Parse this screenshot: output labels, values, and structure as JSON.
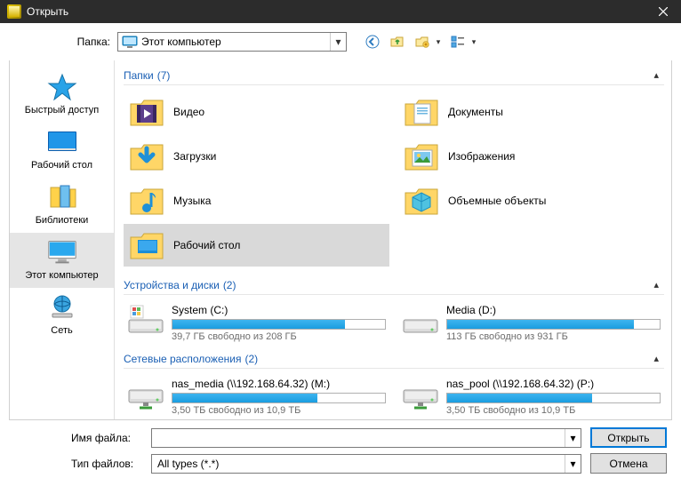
{
  "title": "Открыть",
  "topbar": {
    "folder_label": "Папка:",
    "current_folder": "Этот компьютер"
  },
  "sidebar": {
    "items": [
      {
        "id": "quick",
        "label": "Быстрый доступ"
      },
      {
        "id": "desktop",
        "label": "Рабочий стол"
      },
      {
        "id": "libraries",
        "label": "Библиотеки"
      },
      {
        "id": "thispc",
        "label": "Этот компьютер"
      },
      {
        "id": "network",
        "label": "Сеть"
      }
    ],
    "selected": "thispc"
  },
  "groups": {
    "folders": {
      "title": "Папки",
      "count": "(7)"
    },
    "drives": {
      "title": "Устройства и диски",
      "count": "(2)"
    },
    "network": {
      "title": "Сетевые расположения",
      "count": "(2)"
    }
  },
  "folders": [
    {
      "id": "videos",
      "label": "Видео"
    },
    {
      "id": "documents",
      "label": "Документы"
    },
    {
      "id": "downloads",
      "label": "Загрузки"
    },
    {
      "id": "pictures",
      "label": "Изображения"
    },
    {
      "id": "music",
      "label": "Музыка"
    },
    {
      "id": "3dobjects",
      "label": "Объемные объекты"
    },
    {
      "id": "desktop",
      "label": "Рабочий стол",
      "selected": true
    }
  ],
  "drives": [
    {
      "name": "System (C:)",
      "free": "39,7 ГБ свободно из 208 ГБ",
      "fill_pct": 81,
      "type": "win"
    },
    {
      "name": "Media (D:)",
      "free": "113 ГБ свободно из 931 ГБ",
      "fill_pct": 88,
      "type": "hdd"
    }
  ],
  "netdrives": [
    {
      "name": "nas_media (\\\\192.168.64.32) (M:)",
      "free": "3,50 ТБ свободно из 10,9 ТБ",
      "fill_pct": 68
    },
    {
      "name": "nas_pool (\\\\192.168.64.32) (P:)",
      "free": "3,50 ТБ свободно из 10,9 ТБ",
      "fill_pct": 68
    }
  ],
  "bottom": {
    "filename_label": "Имя файла:",
    "filename_value": "",
    "filetype_label": "Тип файлов:",
    "filetype_value": "All types (*.*)",
    "open_btn": "Открыть",
    "cancel_btn": "Отмена"
  }
}
